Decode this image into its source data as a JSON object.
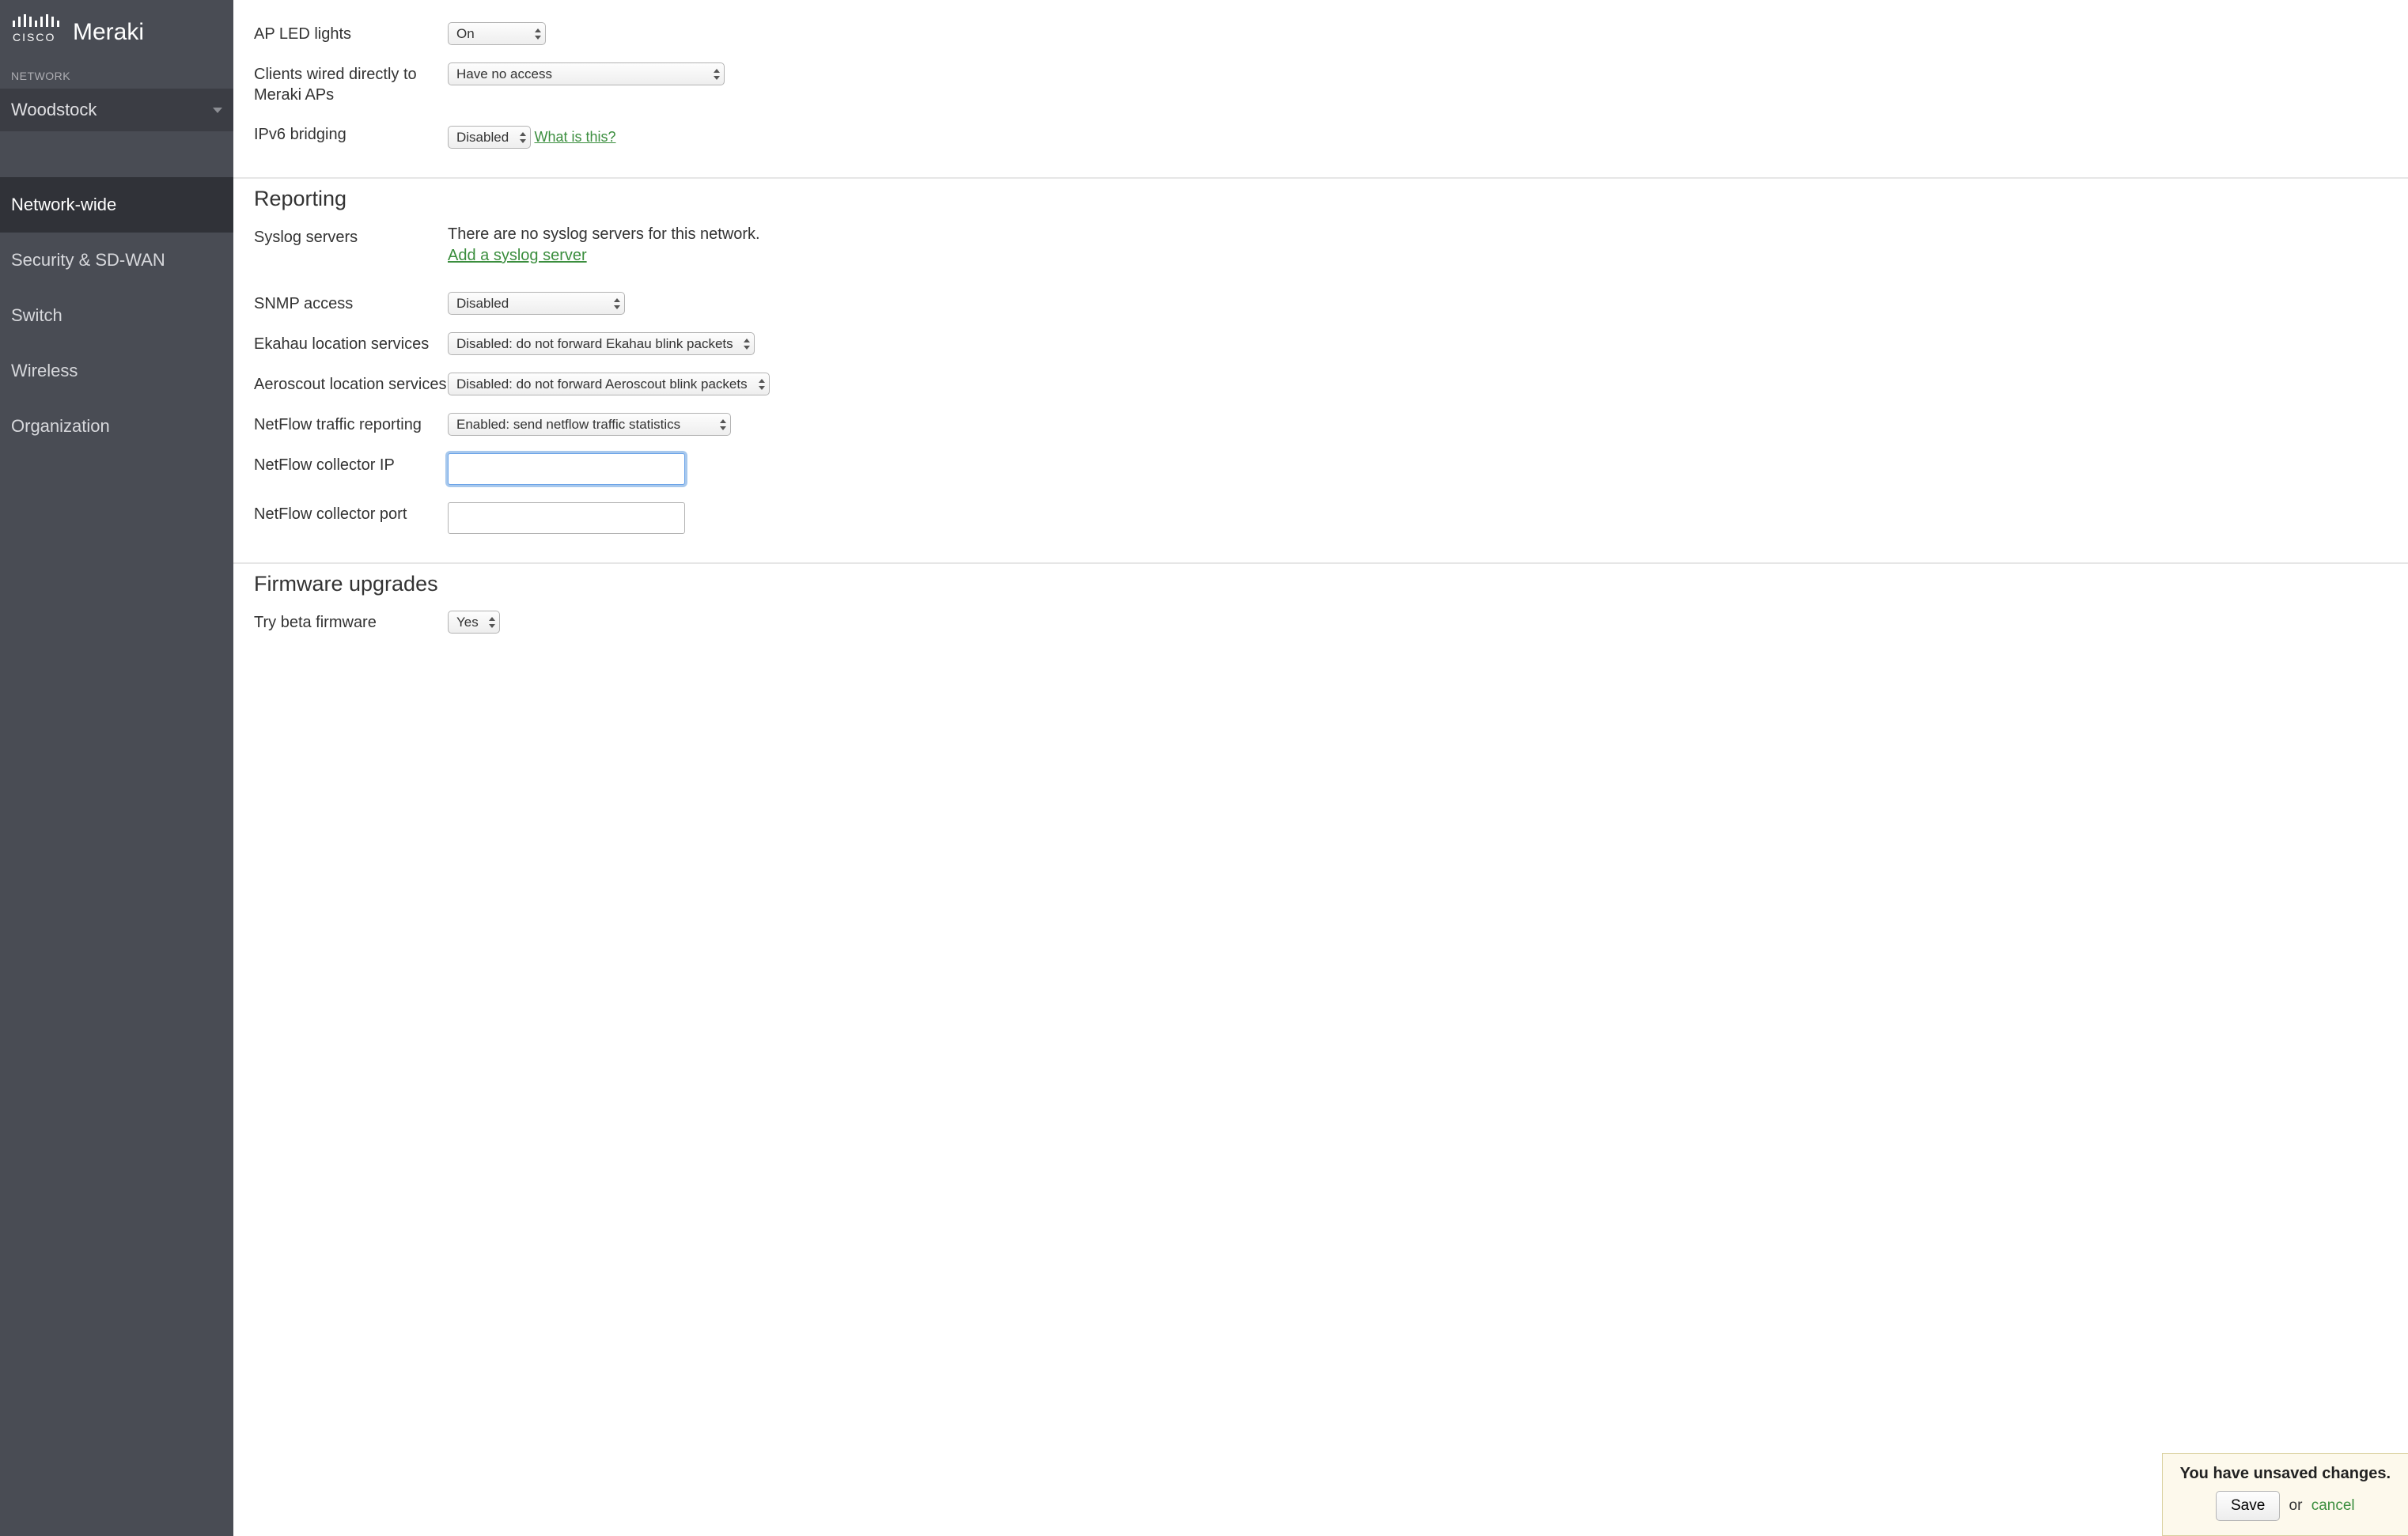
{
  "brand": {
    "vendor": "cisco",
    "product": "Meraki"
  },
  "sidebar": {
    "network_label": "NETWORK",
    "network_name": "Woodstock",
    "items": [
      {
        "label": "Network-wide",
        "active": true
      },
      {
        "label": "Security & SD-WAN",
        "active": false
      },
      {
        "label": "Switch",
        "active": false
      },
      {
        "label": "Wireless",
        "active": false
      },
      {
        "label": "Organization",
        "active": false
      }
    ]
  },
  "top_section": {
    "ap_led_label": "AP LED lights",
    "ap_led_value": "On",
    "clients_wired_label": "Clients wired directly to Meraki APs",
    "clients_wired_value": "Have no access",
    "ipv6_label": "IPv6 bridging",
    "ipv6_value": "Disabled",
    "what_is_this": "What is this?"
  },
  "reporting": {
    "heading": "Reporting",
    "syslog_label": "Syslog servers",
    "syslog_msg": "There are no syslog servers for this network.",
    "syslog_link": "Add a syslog server",
    "snmp_label": "SNMP access",
    "snmp_value": "Disabled",
    "ekahau_label": "Ekahau location services",
    "ekahau_value": "Disabled: do not forward Ekahau blink packets",
    "aeroscout_label": "Aeroscout location services",
    "aeroscout_value": "Disabled: do not forward Aeroscout blink packets",
    "netflow_label": "NetFlow traffic reporting",
    "netflow_value": "Enabled: send netflow traffic statistics",
    "netflow_ip_label": "NetFlow collector IP",
    "netflow_ip_value": "",
    "netflow_port_label": "NetFlow collector port",
    "netflow_port_value": ""
  },
  "firmware": {
    "heading": "Firmware upgrades",
    "beta_label": "Try beta firmware",
    "beta_value": "Yes"
  },
  "unsaved": {
    "title": "You have unsaved changes.",
    "save": "Save",
    "or": "or",
    "cancel": "cancel"
  }
}
